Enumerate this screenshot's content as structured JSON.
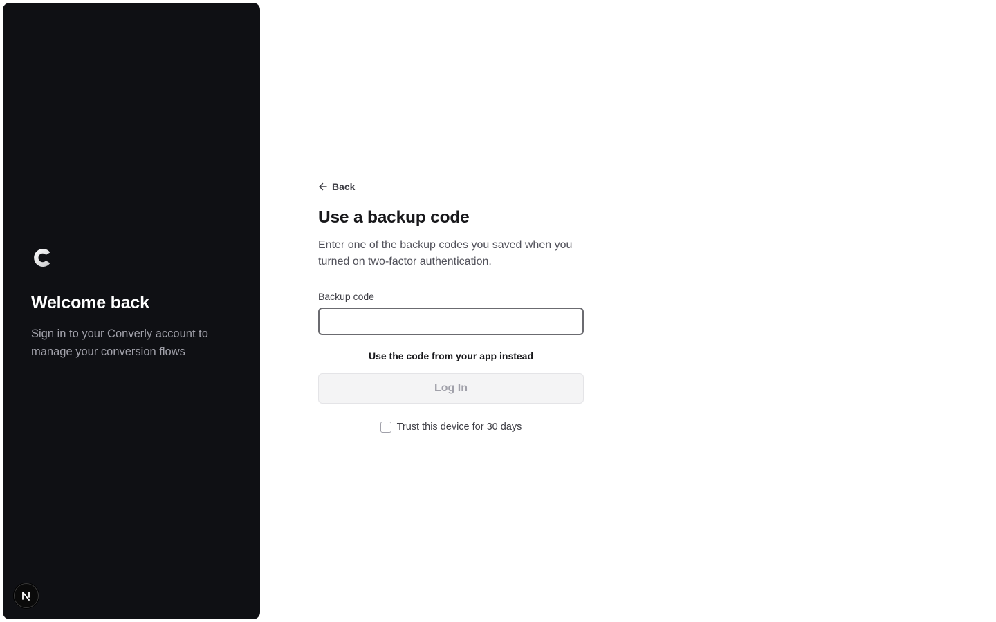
{
  "brand": {
    "logo_icon": "converly-c-logo",
    "welcome_title": "Welcome back",
    "welcome_subtitle": "Sign in to your Converly account to manage your conversion flows",
    "dev_badge_letter": "N"
  },
  "form": {
    "back_label": "Back",
    "title": "Use a backup code",
    "description": "Enter one of the backup codes you saved when you turned on two-factor authentication.",
    "field_label": "Backup code",
    "field_value": "",
    "field_placeholder": "",
    "alt_method_label": "Use the code from your app instead",
    "submit_label": "Log In",
    "trust_label": "Trust this device for 30 days",
    "trust_checked": false
  },
  "colors": {
    "panel_bg": "#0f1014",
    "accent_text": "#18181b",
    "disabled_button_bg": "#f4f4f5"
  }
}
